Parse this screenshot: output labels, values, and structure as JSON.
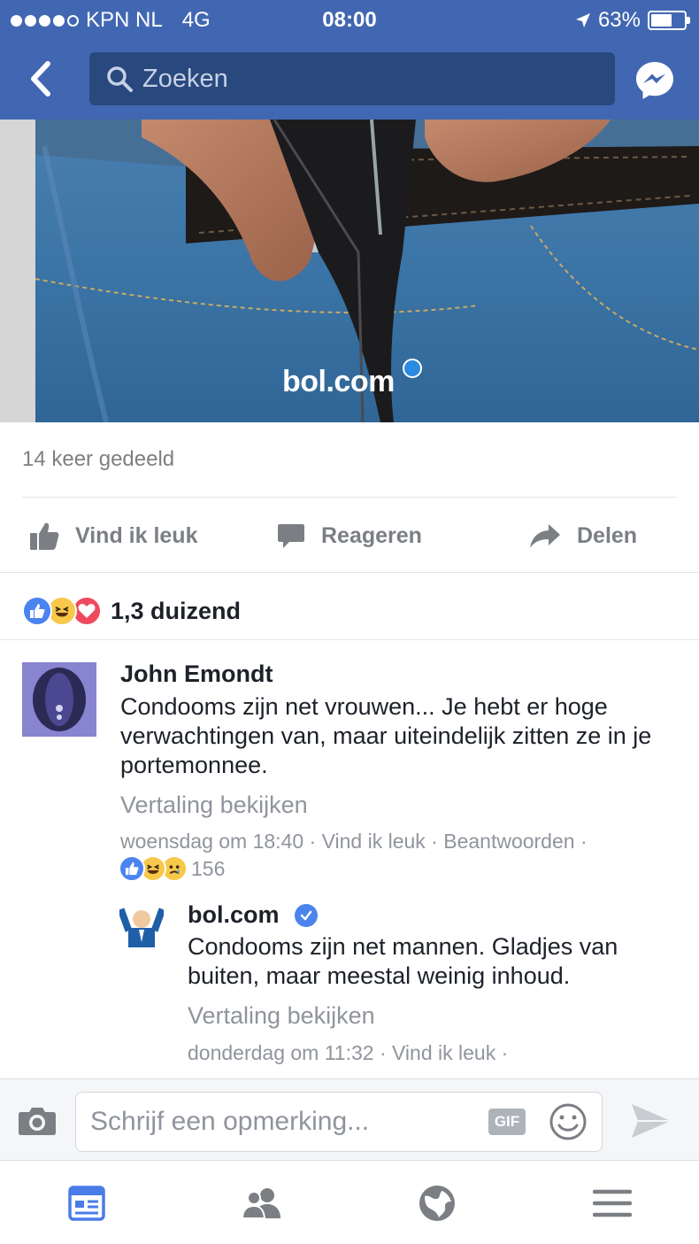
{
  "status_bar": {
    "carrier": "KPN NL",
    "network": "4G",
    "time": "08:00",
    "battery": "63%",
    "battery_level": 0.63
  },
  "search": {
    "placeholder": "Zoeken"
  },
  "post": {
    "image_logo_text": "bol.com",
    "share_count": "14 keer gedeeld",
    "actions": {
      "like": "Vind ik leuk",
      "comment": "Reageren",
      "share": "Delen"
    },
    "reaction_total": "1,3 duizend"
  },
  "comments": [
    {
      "author": "John Emondt",
      "text": "Condooms zijn net vrouwen... Je hebt er hoge verwachtingen van, maar uiteindelijk zitten ze in je portemonnee.",
      "translate": "Vertaling bekijken",
      "meta": "woensdag om 18:40 · Vind ik leuk · Beantwoorden ·",
      "reaction_count": "156"
    },
    {
      "author": "bol.com",
      "text": "Condooms zijn net mannen. Gladjes van buiten, maar meestal weinig inhoud.",
      "translate": "Vertaling bekijken",
      "meta": "donderdag om 11:32 · Vind ik leuk ·"
    }
  ],
  "composer": {
    "placeholder": "Schrijf een opmerking...",
    "gif_label": "GIF"
  },
  "colors": {
    "brand": "#4267b2",
    "search_bg": "#29487d",
    "muted_text": "#90949c",
    "like": "#4b83f0",
    "love": "#f0495f",
    "haha": "#f7c84a"
  },
  "icons": {
    "back": "chevron-left-icon",
    "search": "search-icon",
    "messenger": "messenger-icon",
    "like": "thumbs-up-icon",
    "comment": "speech-bubble-icon",
    "share": "share-arrow-icon",
    "camera": "camera-icon",
    "emoji": "smiley-icon",
    "send": "send-icon",
    "nav": [
      "news-feed-icon",
      "friends-icon",
      "globe-icon",
      "menu-icon"
    ]
  }
}
